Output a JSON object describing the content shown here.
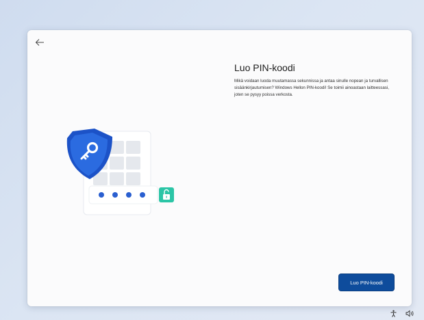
{
  "window": {
    "title": "Luo PIN-koodi",
    "description": "Mikä voidaan luoda muutamassa sekunnissa ja antaa sinulle nopean ja turvallisen sisäänkirjautumisen? Windows Hellon PIN-koodi! Se toimii ainoastaan laitteessasi, joten se pysyy poissa verkosta.",
    "primary_button": "Luo PIN-koodi"
  },
  "icons": {
    "back": "back-arrow-icon",
    "shield": "shield-key-icon",
    "lock": "unlocked-padlock-icon",
    "accessibility": "accessibility-icon",
    "volume": "volume-icon"
  },
  "colors": {
    "accent": "#0e4c9c",
    "shield": "#1f5fd1",
    "pin_dots": "#2a5fd0",
    "lock_tile": "#2bc5a6"
  }
}
